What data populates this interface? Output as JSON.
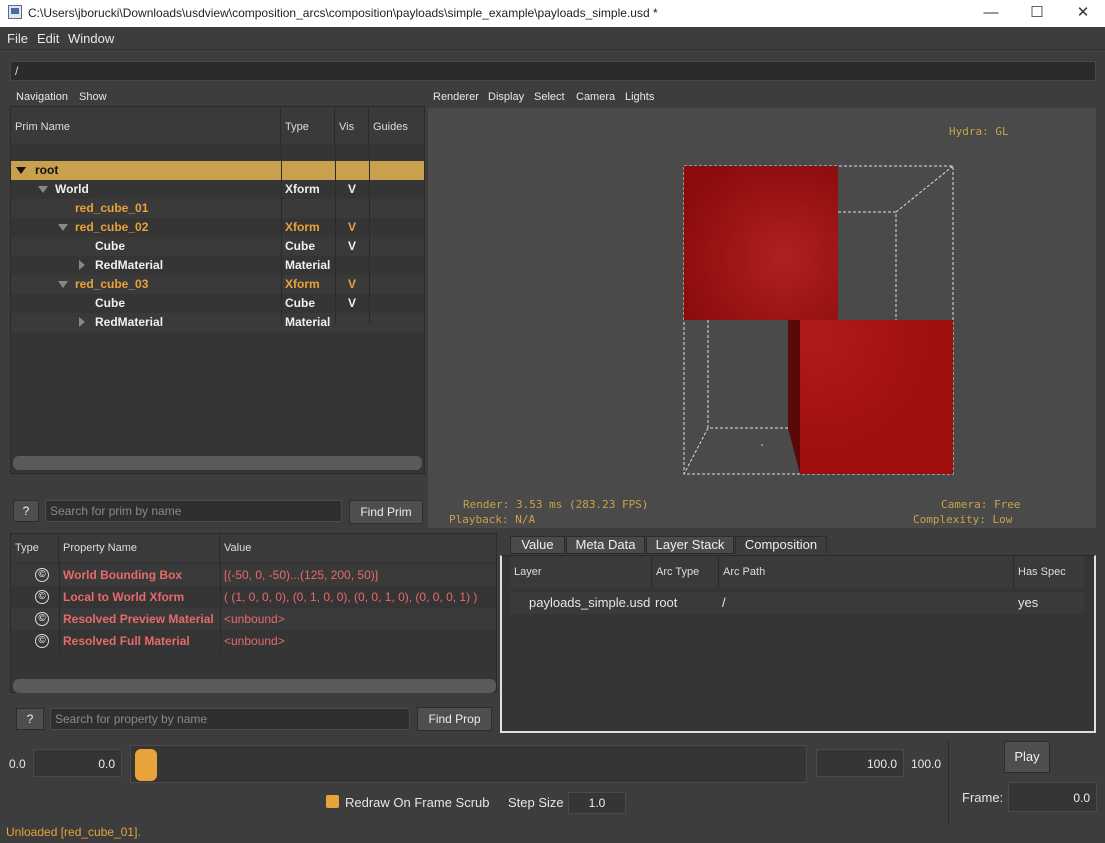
{
  "window": {
    "title": "C:\\Users\\jborucki\\Downloads\\usdview\\composition_arcs\\composition\\payloads\\simple_example\\payloads_simple.usd *",
    "minimize": "—",
    "maximize": "☐",
    "close": "✕"
  },
  "menubar": {
    "file": "File",
    "edit": "Edit",
    "window": "Window"
  },
  "path": "/",
  "prim_panel": {
    "menus": [
      "Navigation",
      "Show"
    ],
    "headers": {
      "name": "Prim Name",
      "type": "Type",
      "vis": "Vis",
      "guides": "Guides"
    },
    "rows": [
      {
        "name": "root",
        "type": "",
        "vis": ""
      },
      {
        "name": "World",
        "type": "Xform",
        "vis": "V"
      },
      {
        "name": "red_cube_01",
        "type": "",
        "vis": ""
      },
      {
        "name": "red_cube_02",
        "type": "Xform",
        "vis": "V"
      },
      {
        "name": "Cube",
        "type": "Cube",
        "vis": "V"
      },
      {
        "name": "RedMaterial",
        "type": "Material",
        "vis": ""
      },
      {
        "name": "red_cube_03",
        "type": "Xform",
        "vis": "V"
      },
      {
        "name": "Cube",
        "type": "Cube",
        "vis": "V"
      },
      {
        "name": "RedMaterial",
        "type": "Material",
        "vis": ""
      }
    ],
    "help": "?",
    "search_placeholder": "Search for prim by name",
    "find_button": "Find Prim"
  },
  "viewport": {
    "menus": [
      "Renderer",
      "Display",
      "Select",
      "Camera",
      "Lights"
    ],
    "hud": {
      "renderer": "Hydra: GL",
      "render": "Render: 3.53 ms (283.23 FPS)",
      "playback": "Playback: N/A",
      "camera": "Camera: Free",
      "complexity": "Complexity: Low"
    }
  },
  "property_panel": {
    "headers": {
      "type": "Type",
      "name": "Property Name",
      "value": "Value"
    },
    "rows": [
      {
        "icon": "©",
        "name": "World Bounding Box",
        "value": "[(-50, 0, -50)...(125, 200, 50)]"
      },
      {
        "icon": "©",
        "name": "Local to World Xform",
        "value": "( (1, 0, 0, 0), (0, 1, 0, 0), (0, 0, 1, 0), (0, 0, 0, 1) )"
      },
      {
        "icon": "©",
        "name": "Resolved Preview Material",
        "value": "<unbound>"
      },
      {
        "icon": "©",
        "name": "Resolved Full Material",
        "value": "<unbound>"
      }
    ],
    "help": "?",
    "search_placeholder": "Search for property by name",
    "find_button": "Find Prop"
  },
  "composition_panel": {
    "tabs": [
      "Value",
      "Meta Data",
      "Layer Stack",
      "Composition"
    ],
    "headers": {
      "layer": "Layer",
      "arc_type": "Arc Type",
      "arc_path": "Arc Path",
      "has_spec": "Has Spec"
    },
    "rows": [
      {
        "layer": "payloads_simple.usd",
        "arc_type": "root",
        "arc_path": "/",
        "has_spec": "yes"
      }
    ]
  },
  "timeline": {
    "start_label": "0.0",
    "start_field": "0.0",
    "end_field": "100.0",
    "end_label": "100.0",
    "play": "Play",
    "redraw_label": "Redraw On Frame Scrub",
    "step_label": "Step Size",
    "step_value": "1.0",
    "frame_label": "Frame:",
    "frame_value": "0.0"
  },
  "status": "Unloaded [red_cube_01].",
  "colors": {
    "accent": "#e8a33a",
    "selection": "#c9a04e",
    "cube_red": "#a01010",
    "prop_red": "#e86a6a"
  }
}
